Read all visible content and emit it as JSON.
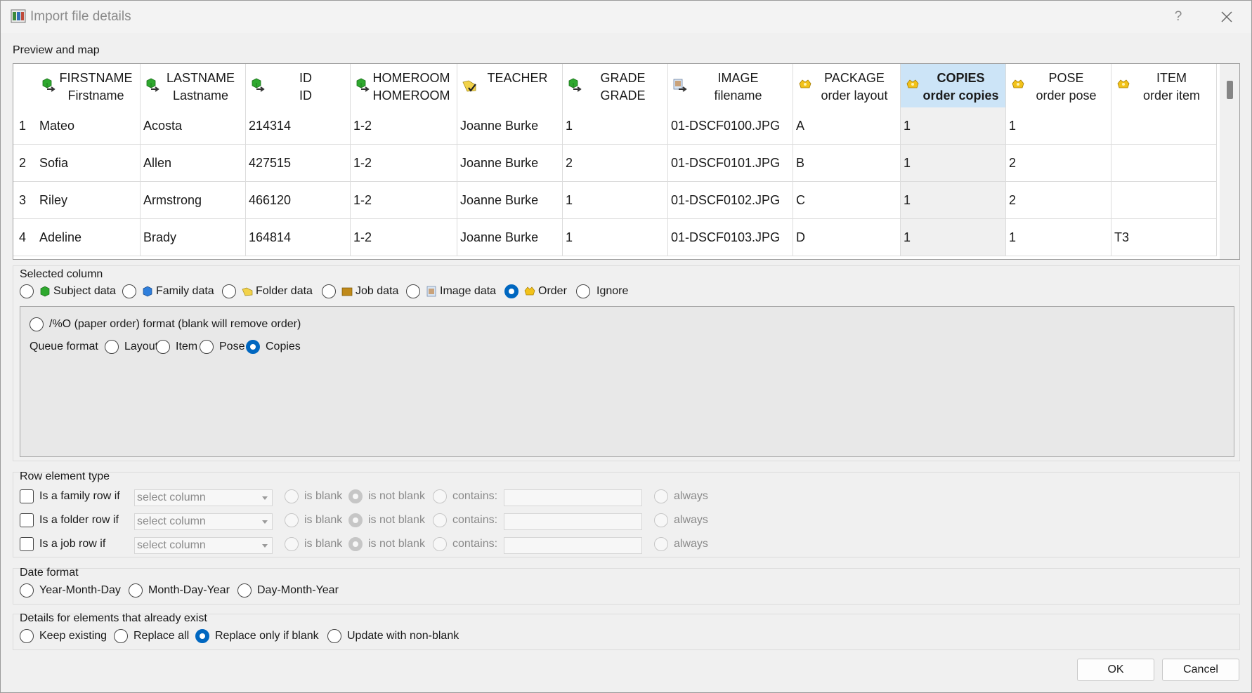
{
  "window": {
    "title": "Import file details",
    "help": "?"
  },
  "preview": {
    "label": "Preview and map",
    "columns": [
      {
        "top": "FIRSTNAME",
        "bottom": "Firstname",
        "icon": "subject-icon"
      },
      {
        "top": "LASTNAME",
        "bottom": "Lastname",
        "icon": "subject-icon"
      },
      {
        "top": "ID",
        "bottom": "ID",
        "icon": "subject-icon"
      },
      {
        "top": "HOMEROOM",
        "bottom": "HOMEROOM",
        "icon": "subject-icon"
      },
      {
        "top": "TEACHER",
        "bottom": "",
        "icon": "folder-data-icon"
      },
      {
        "top": "GRADE",
        "bottom": "GRADE",
        "icon": "subject-icon"
      },
      {
        "top": "IMAGE",
        "bottom": "filename",
        "icon": "image-data-icon"
      },
      {
        "top": "PACKAGE",
        "bottom": "order layout",
        "icon": "order-icon"
      },
      {
        "top": "COPIES",
        "bottom": "order copies",
        "icon": "order-icon",
        "selected": true
      },
      {
        "top": "POSE",
        "bottom": "order pose",
        "icon": "order-icon"
      },
      {
        "top": "ITEM",
        "bottom": "order item",
        "icon": "order-icon"
      }
    ],
    "rows": [
      {
        "num": "1",
        "cells": [
          "Mateo",
          "Acosta",
          "214314",
          "1-2",
          "Joanne Burke",
          "1",
          "01-DSCF0100.JPG",
          "A",
          "1",
          "1",
          ""
        ]
      },
      {
        "num": "2",
        "cells": [
          "Sofia",
          "Allen",
          "427515",
          "1-2",
          "Joanne Burke",
          "2",
          "01-DSCF0101.JPG",
          "B",
          "1",
          "2",
          ""
        ]
      },
      {
        "num": "3",
        "cells": [
          "Riley",
          "Armstrong",
          "466120",
          "1-2",
          "Joanne Burke",
          "1",
          "01-DSCF0102.JPG",
          "C",
          "1",
          "2",
          ""
        ]
      },
      {
        "num": "4",
        "cells": [
          "Adeline",
          "Brady",
          "164814",
          "1-2",
          "Joanne Burke",
          "1",
          "01-DSCF0103.JPG",
          "D",
          "1",
          "1",
          "T3"
        ]
      }
    ]
  },
  "selected_column": {
    "label": "Selected column",
    "options": [
      "Subject data",
      "Family data",
      "Folder data",
      "Job data",
      "Image data",
      "Order",
      "Ignore"
    ],
    "selected": "Order",
    "paper_order_label": "/%O (paper order) format (blank will remove order)",
    "queue_format_label": "Queue format",
    "queue_options": [
      "Layout",
      "Item",
      "Pose",
      "Copies"
    ],
    "queue_selected": "Copies"
  },
  "row_element": {
    "label": "Row element type",
    "rows": [
      {
        "label": "Is a family row if"
      },
      {
        "label": "Is a folder row if"
      },
      {
        "label": "Is a job row if"
      }
    ],
    "combo_placeholder": "select column",
    "is_blank": "is blank",
    "is_not_blank": "is not blank",
    "contains": "contains:",
    "always": "always"
  },
  "date_format": {
    "label": "Date format",
    "options": [
      "Year-Month-Day",
      "Month-Day-Year",
      "Day-Month-Year"
    ]
  },
  "existing": {
    "label": "Details for elements that already exist",
    "options": [
      "Keep existing",
      "Replace all",
      "Replace only if blank",
      "Update with non-blank"
    ],
    "selected": "Replace only if blank"
  },
  "buttons": {
    "ok": "OK",
    "cancel": "Cancel"
  },
  "colors": {
    "accent": "#0067c0",
    "selected_header": "#cce4f7"
  }
}
